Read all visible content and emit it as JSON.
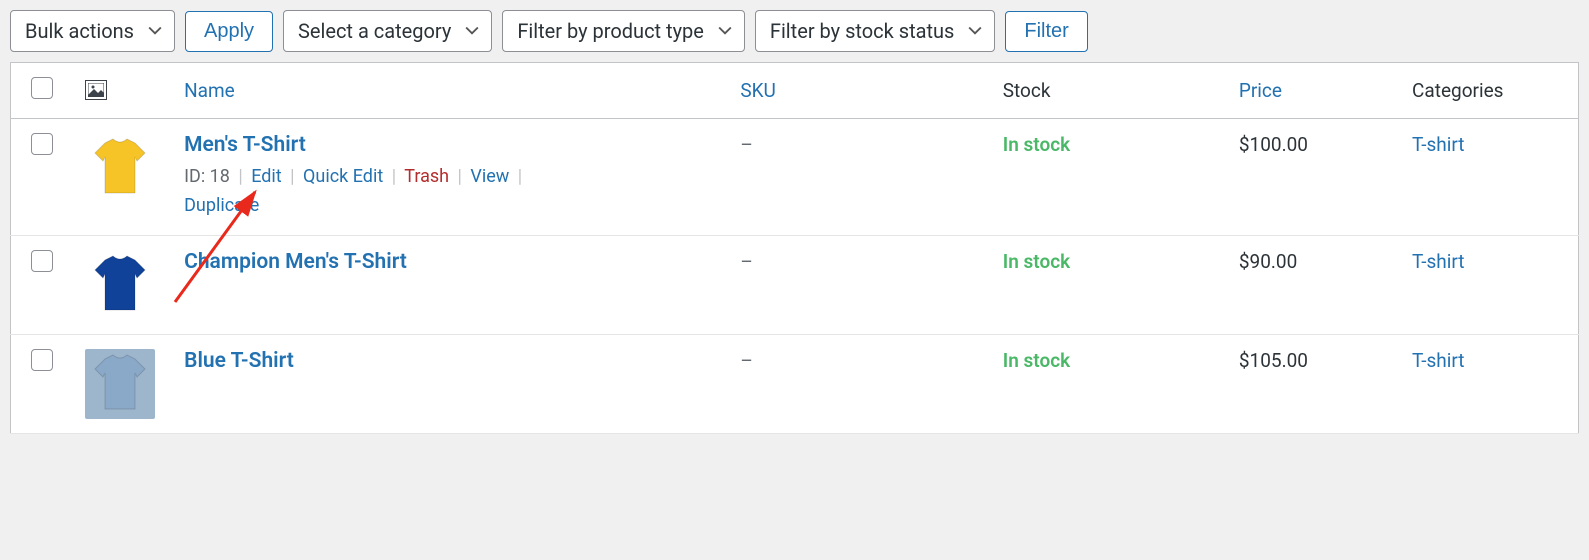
{
  "toolbar": {
    "bulk_actions": "Bulk actions",
    "apply": "Apply",
    "select_category": "Select a category",
    "filter_product_type": "Filter by product type",
    "filter_stock_status": "Filter by stock status",
    "filter": "Filter"
  },
  "columns": {
    "name": "Name",
    "sku": "SKU",
    "stock": "Stock",
    "price": "Price",
    "categories": "Categories"
  },
  "row_actions": {
    "id_prefix": "ID: ",
    "edit": "Edit",
    "quick_edit": "Quick Edit",
    "trash": "Trash",
    "view": "View",
    "duplicate": "Duplicate"
  },
  "products": [
    {
      "id": "18",
      "name": "Men's T-Shirt",
      "sku": "–",
      "stock": "In stock",
      "price": "$100.00",
      "category": "T-shirt",
      "thumb_color": "#f7c427",
      "show_actions": true
    },
    {
      "id": "",
      "name": "Champion Men's T-Shirt",
      "sku": "–",
      "stock": "In stock",
      "price": "$90.00",
      "category": "T-shirt",
      "thumb_color": "#10429a",
      "show_actions": false
    },
    {
      "id": "",
      "name": "Blue T-Shirt",
      "sku": "–",
      "stock": "In stock",
      "price": "$105.00",
      "category": "T-shirt",
      "thumb_color": "#8aa8c8",
      "thumb_bg": "#9db6cc",
      "show_actions": false
    }
  ]
}
